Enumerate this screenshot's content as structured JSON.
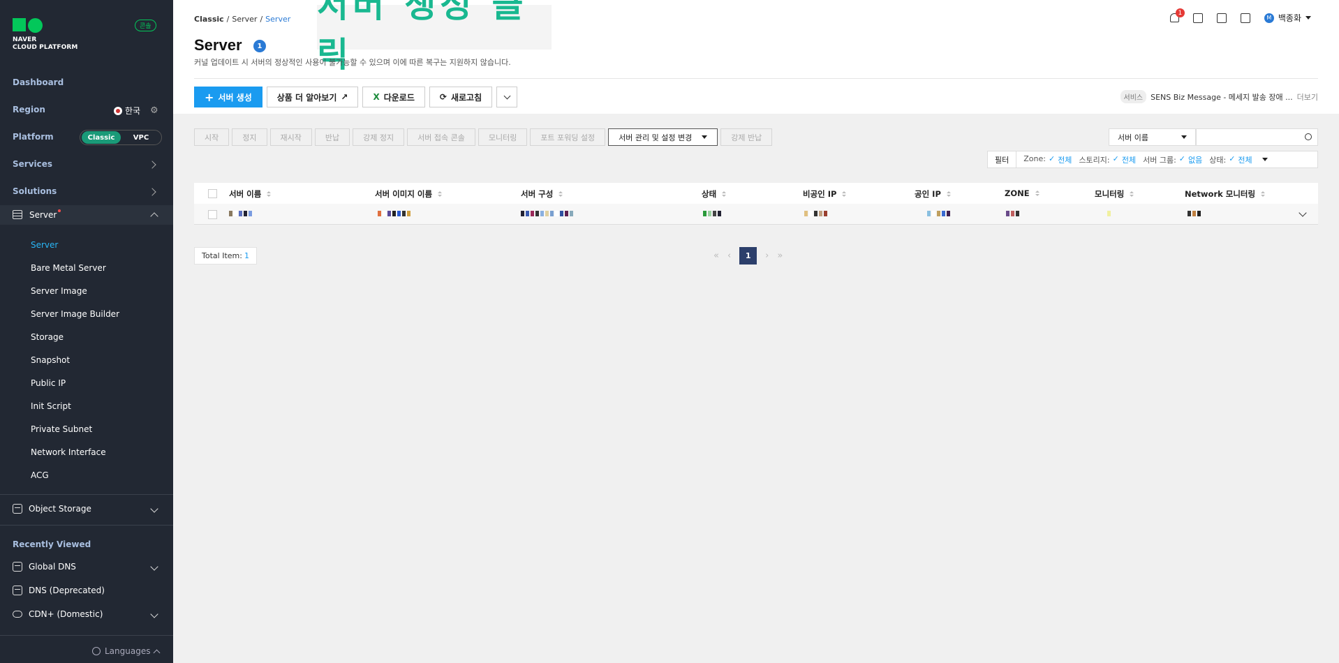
{
  "sidebar": {
    "logo_line1": "NAVER",
    "logo_line2": "CLOUD PLATFORM",
    "console_badge": "콘솔",
    "dashboard": "Dashboard",
    "region_label": "Region",
    "region_value": "한국",
    "platform_label": "Platform",
    "platform_on": "Classic",
    "platform_off": "VPC",
    "services": "Services",
    "solutions": "Solutions",
    "server_group": "Server",
    "server_items": [
      "Server",
      "Bare Metal Server",
      "Server Image",
      "Server Image Builder",
      "Storage",
      "Snapshot",
      "Public IP",
      "Init Script",
      "Private Subnet",
      "Network Interface",
      "ACG"
    ],
    "object_storage": "Object Storage",
    "recently_viewed": "Recently Viewed",
    "recent_items": [
      "Global DNS",
      "DNS (Deprecated)",
      "CDN+ (Domestic)"
    ],
    "languages": "Languages"
  },
  "header": {
    "breadcrumb": [
      "Classic",
      "/",
      "Server",
      "/",
      "Server"
    ],
    "overlay": "서버 생성 클릭",
    "title": "Server",
    "title_count": "1",
    "description": "커널 업데이트 시 서버의 정상적인 사용이 불가능할 수 있으며 이에 따른 복구는 지원하지 않습니다.",
    "notif_count": "1",
    "user_initial": "M",
    "user_name": "백종화"
  },
  "toolbar": {
    "create": "서버 생성",
    "learn_more": "상품 더 알아보기",
    "download": "다운로드",
    "download_x": "X",
    "refresh": "새로고침"
  },
  "notice": {
    "tag": "서비스",
    "text": "SENS Biz Message - 메세지 발송 장애 ...",
    "more": "더보기"
  },
  "actions": {
    "start": "시작",
    "stop": "정지",
    "restart": "재시작",
    "return": "반납",
    "force_stop": "강제 정지",
    "console": "서버 접속 콘솔",
    "monitoring": "모니터링",
    "port_forward": "포트 포워딩 설정",
    "manage": "서버 관리 및 설정 변경",
    "force_return": "강제 반납"
  },
  "search": {
    "select": "서버 이름"
  },
  "filter": {
    "label": "필터",
    "zone_label": "Zone:",
    "zone_value": "전체",
    "storage_label": "스토리지:",
    "storage_value": "전체",
    "group_label": "서버 그룹:",
    "group_value": "없음",
    "status_label": "상태:",
    "status_value": "전체"
  },
  "table": {
    "columns": [
      "서버 이름",
      "서버 이미지 이름",
      "서버 구성",
      "상태",
      "비공인 IP",
      "공인 IP",
      "ZONE",
      "모니터링",
      "Network 모니터링"
    ]
  },
  "footer": {
    "total_label": "Total Item:",
    "total_value": "1",
    "current_page": "1"
  }
}
